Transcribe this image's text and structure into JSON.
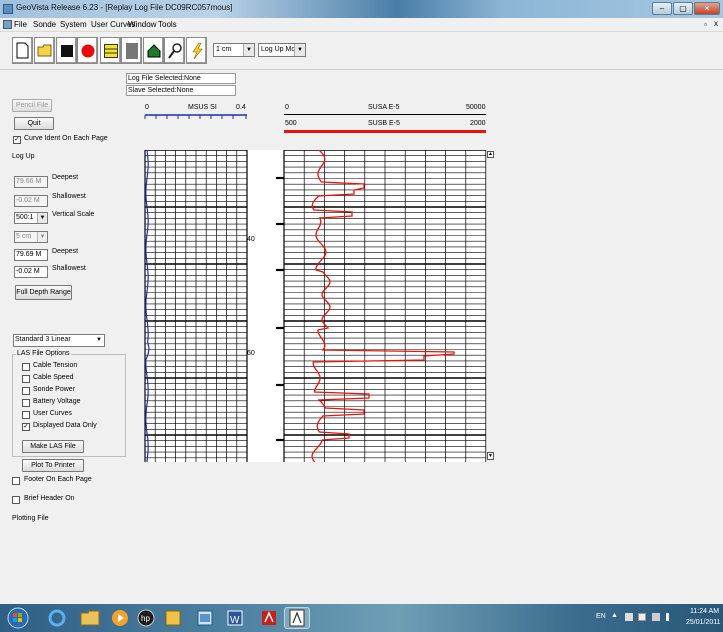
{
  "window": {
    "title": "GeoVista Release 6.23 - [Replay Log File DC09RC057mous]",
    "min": "–",
    "max": "▢",
    "close": "✕",
    "mdi_restore": "▫",
    "mdi_close": "x"
  },
  "menu": [
    "File",
    "Sonde",
    "System",
    "User Curves",
    "Window",
    "Tools"
  ],
  "toolbar": {
    "scale_combo": "1 cm",
    "mode_combo": "Log Up Mode"
  },
  "info": {
    "log_file": "Log File Selected:None",
    "slave": "Slave Selected:None"
  },
  "left_panel": {
    "pencil_file": "Pencil File",
    "quit": "Quit",
    "curve_ident": "Curve Ident On Each Page",
    "log_direction": "Log Up",
    "deepest_1": "79.66 M",
    "deepest_1_label": "Deepest",
    "shallowest_1": "-0.02 M",
    "shallowest_1_label": "Shallowest",
    "vertical_scale": "500:1",
    "vertical_scale_label": "Vertical Scale",
    "cm_value": "5 cm",
    "deepest_2": "79.69 M",
    "deepest_2_label": "Deepest",
    "shallowest_2": "-0.02 M",
    "shallowest_2_label": "Shallowest",
    "full_depth": "Full Depth Range",
    "template": "Standard 3 Linear",
    "las_group": "LAS File Options",
    "las_options": [
      {
        "label": "Cable Tension",
        "checked": false
      },
      {
        "label": "Cable Speed",
        "checked": false
      },
      {
        "label": "Sonde Power",
        "checked": false
      },
      {
        "label": "Battery Voltage",
        "checked": false
      },
      {
        "label": "User Curves",
        "checked": false
      },
      {
        "label": "Displayed Data Only",
        "checked": true
      }
    ],
    "make_las": "Make LAS File",
    "plot_to_printer": "Plot To Printer",
    "footer": "Footer On Each Page",
    "brief_header": "Brief Header On",
    "plotting_file": "Plotting File"
  },
  "plot_headers": {
    "track1_min": "0",
    "track1_name": "MSUS SI",
    "track1_max": "0.4",
    "track2_min": "0",
    "track2_name": "SUSA E-5",
    "track2_max": "50000",
    "track2b_min": "500",
    "track2b_name": "SUSB E-5",
    "track2b_max": "2000"
  },
  "depth_labels": [
    "40",
    "60"
  ],
  "taskbar": {
    "lang": "EN",
    "time": "11:24 AM",
    "date": "25/01/2011"
  },
  "colors": {
    "curve_red": "#e8140c",
    "curve_blue": "#1a2fb5"
  }
}
